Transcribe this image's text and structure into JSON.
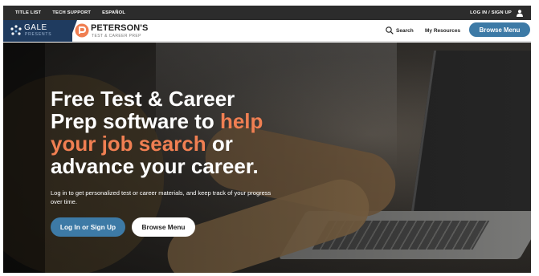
{
  "utility_bar": {
    "links": [
      "TITLE LIST",
      "TECH SUPPORT",
      "ESPAÑOL"
    ],
    "login": "LOG IN / SIGN UP",
    "user_icon": "user-icon"
  },
  "header": {
    "gale": {
      "name": "GALE",
      "sub": "PRESENTS"
    },
    "petersons": {
      "name": "PETERSON'S",
      "sub": "TEST & CAREER PREP"
    },
    "search_label": "Search",
    "search_icon": "search-icon",
    "resources_label": "My Resources",
    "browse_label": "Browse Menu"
  },
  "hero": {
    "line1": "Free Test & Career",
    "line2a": "Prep software to ",
    "line2b": "help",
    "line3a": "your job search",
    "line3b": " or",
    "line4": "advance your career.",
    "subtext": "Log in to get personalized test or career materials, and keep track of your progress over time.",
    "login_button": "Log In or Sign Up",
    "browse_button": "Browse Menu"
  },
  "colors": {
    "accent": "#f07f52",
    "primary": "#3d7aa6",
    "topbar": "#2c2c2c",
    "gale_bg": "#1f3b5f"
  }
}
